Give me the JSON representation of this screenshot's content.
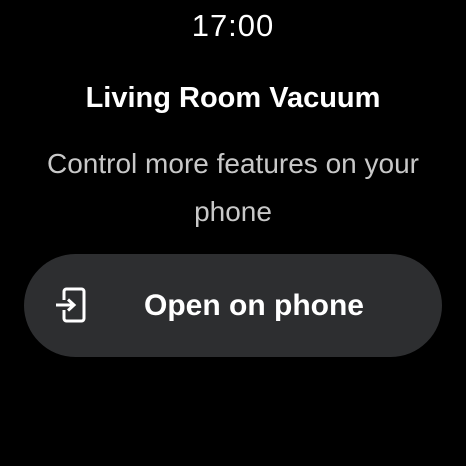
{
  "status": {
    "time": "17:00"
  },
  "device": {
    "name": "Living Room Vacuum"
  },
  "message": {
    "text": "Control more features on your phone"
  },
  "action": {
    "label": "Open on phone",
    "icon": "open-on-phone-icon"
  },
  "colors": {
    "background": "#000000",
    "button_bg": "#2d2e30",
    "primary_text": "#ffffff",
    "secondary_text": "#c8c8c8"
  }
}
